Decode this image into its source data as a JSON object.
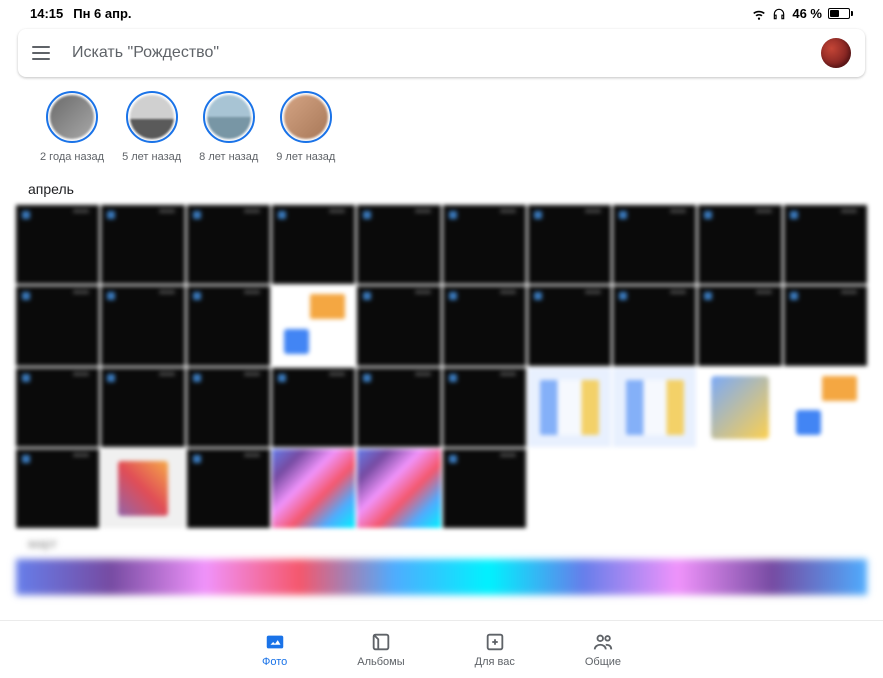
{
  "status": {
    "time": "14:15",
    "date": "Пн 6 апр.",
    "battery": "46 %"
  },
  "search": {
    "placeholder": "Искать \"Рождество\""
  },
  "memories": [
    {
      "label": "2 года назад"
    },
    {
      "label": "5 лет назад"
    },
    {
      "label": "8 лет назад"
    },
    {
      "label": "9 лет назад"
    }
  ],
  "section": {
    "month": "апрель",
    "next": "март"
  },
  "nav": {
    "photos": "Фото",
    "albums": "Альбомы",
    "for_you": "Для вас",
    "sharing": "Общие"
  }
}
